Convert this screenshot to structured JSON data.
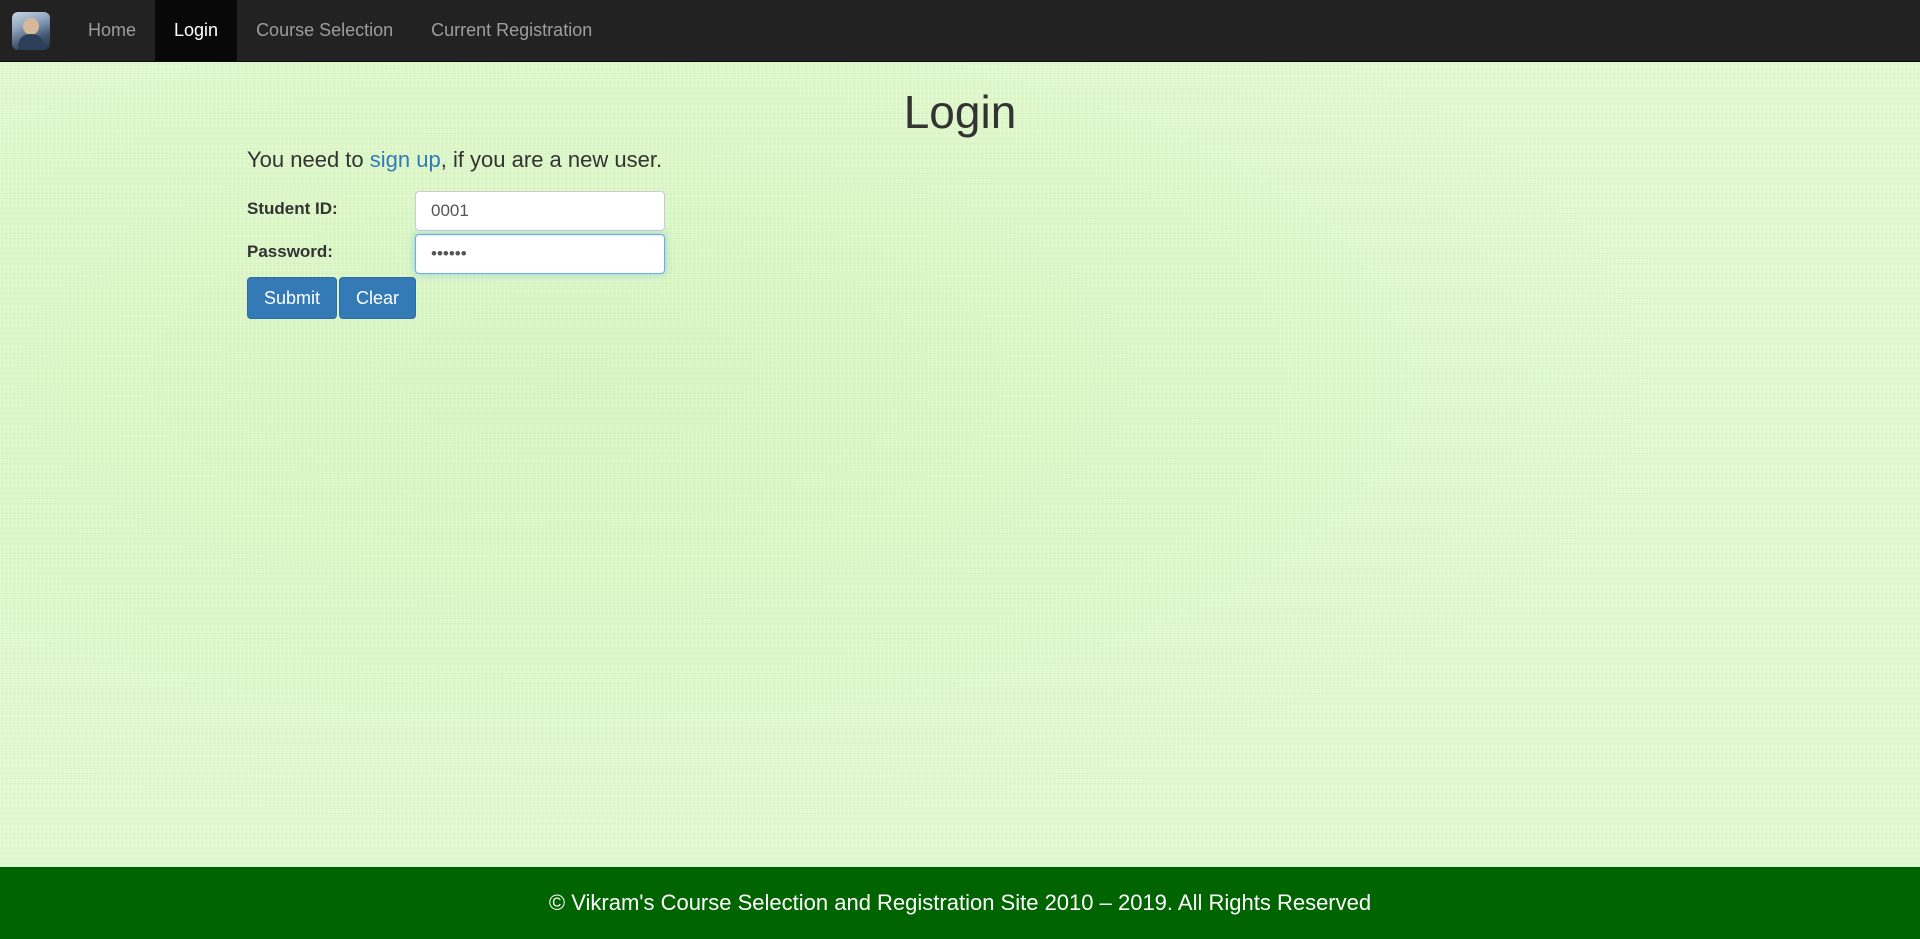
{
  "nav": {
    "brand_icon": "user-avatar-logo",
    "items": [
      {
        "label": "Home",
        "active": false
      },
      {
        "label": "Login",
        "active": true
      },
      {
        "label": "Course Selection",
        "active": false
      },
      {
        "label": "Current Registration",
        "active": false
      }
    ]
  },
  "main": {
    "title": "Login",
    "intro_prefix": "You need to ",
    "signup_link": "sign up",
    "intro_suffix": ", if you are a new user.",
    "student_id_label": "Student ID:",
    "student_id_value": "0001",
    "password_label": "Password:",
    "password_value": "••••••",
    "submit_label": "Submit",
    "clear_label": "Clear"
  },
  "footer": {
    "text": "© Vikram's Course Selection and Registration Site 2010 – 2019. All Rights Reserved"
  },
  "colors": {
    "navbar": "#222222",
    "nav_active": "#080808",
    "page_background": "#e2f9cf",
    "button": "#337ab7",
    "link": "#337ab7",
    "footer": "#006400"
  }
}
